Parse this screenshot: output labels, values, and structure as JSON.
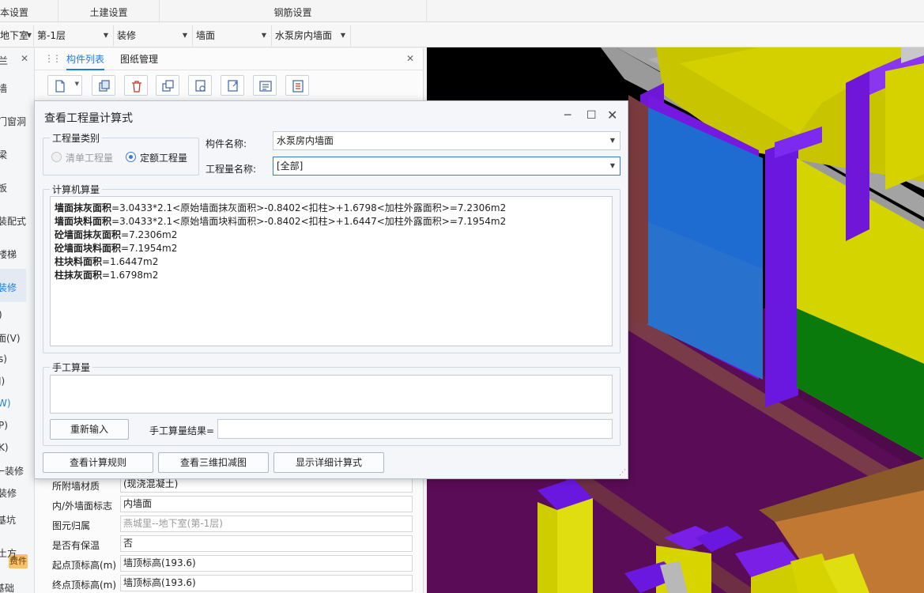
{
  "top_tabs": [
    "本设置",
    "土建设置",
    "钢筋设置"
  ],
  "selectors": [
    {
      "label": "地下室"
    },
    {
      "label": "第-1层"
    },
    {
      "label": "装修"
    },
    {
      "label": "墙面"
    },
    {
      "label": "水泵房内墙面"
    }
  ],
  "left_nav": {
    "items": [
      "兰",
      "墙",
      "门窗洞",
      "梁",
      "板",
      "装配式",
      "楼梯",
      "装修",
      ")",
      "面(V)",
      "s)",
      "J)",
      "W)",
      "P)",
      "K)",
      "一装修",
      "装修",
      "基坑",
      "土方",
      "基础"
    ],
    "active_index": 7,
    "badge": "费件"
  },
  "panel": {
    "tabs": [
      "构件列表",
      "图纸管理"
    ],
    "toolbar_icons": [
      "new-icon",
      "copy-icon",
      "delete-icon",
      "duplicate-icon",
      "layer-copy-icon",
      "export-icon",
      "list-icon",
      "properties-icon"
    ],
    "props": [
      {
        "label": "所附墙材质",
        "value": "(现浇混凝土)"
      },
      {
        "label": "内/外墙面标志",
        "value": "内墙面"
      },
      {
        "label": "图元归属",
        "value": "燕城里--地下室(第-1层)"
      },
      {
        "label": "是否有保温",
        "value": "否"
      },
      {
        "label": "起点顶标高(m)",
        "value": "墙顶标高(193.6)"
      },
      {
        "label": "终点顶标高(m)",
        "value": "墙顶标高(193.6)"
      }
    ]
  },
  "dialog": {
    "title": "查看工程量计算式",
    "type_group": {
      "title": "工程量类别",
      "options": [
        "清单工程量",
        "定额工程量"
      ],
      "selected": 1
    },
    "component_name_label": "构件名称:",
    "component_name_value": "水泵房内墙面",
    "quantity_name_label": "工程量名称:",
    "quantity_name_value": "[全部]",
    "computer_group_title": "计算机算量",
    "calc_lines": [
      {
        "name": "墙面抹灰面积",
        "expr": "=3.0433*2.1<原始墙面抹灰面积>-0.8402<扣柱>+1.6798<加柱外露面积>=7.2306m2"
      },
      {
        "name": "墙面块料面积",
        "expr": "=3.0433*2.1<原始墙面块料面积>-0.8402<扣柱>+1.6447<加柱外露面积>=7.1954m2"
      },
      {
        "name": "砼墙面抹灰面积",
        "expr": "=7.2306m2"
      },
      {
        "name": "砼墙面块料面积",
        "expr": "=7.1954m2"
      },
      {
        "name": "柱块料面积",
        "expr": "=1.6447m2"
      },
      {
        "name": "柱抹灰面积",
        "expr": "=1.6798m2"
      }
    ],
    "manual_group_title": "手工算量",
    "reenter_button": "重新输入",
    "manual_result_label": "手工算量结果=",
    "bottom_buttons": [
      "查看计算规则",
      "查看三维扣减图",
      "显示详细计算式"
    ]
  }
}
